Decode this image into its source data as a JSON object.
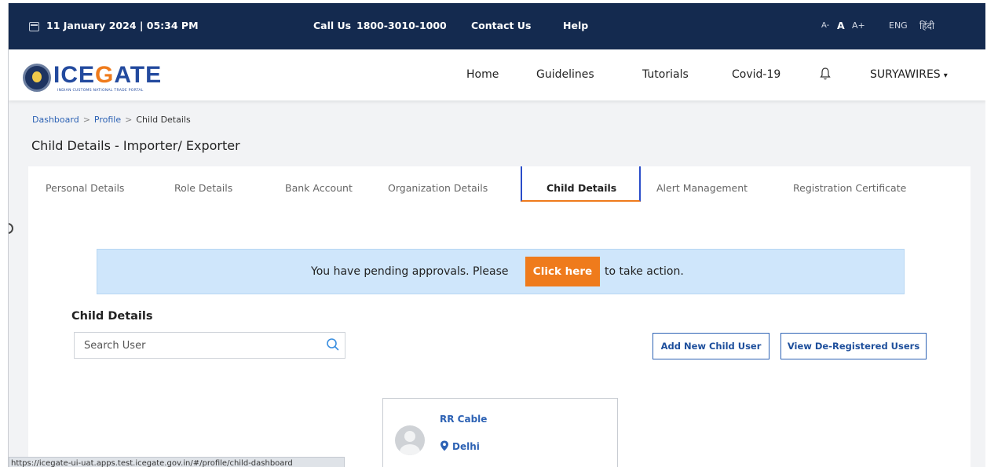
{
  "topbar": {
    "datetime": "11 January 2024 | 05:34 PM",
    "call_label": "Call Us",
    "phone": "1800-3010-1000",
    "contact": "Contact Us",
    "help": "Help",
    "font_small": "A-",
    "font_normal": "A",
    "font_large": "A+",
    "lang_eng": "ENG",
    "lang_hindi": "हिंदी"
  },
  "header": {
    "logo_main": "ICEGATE",
    "logo_sub": "INDIAN CUSTOMS NATIONAL TRADE PORTAL",
    "nav": [
      "Home",
      "Guidelines",
      "Tutorials",
      "Covid-19"
    ],
    "user": "SURYAWIRES"
  },
  "breadcrumb": [
    "Dashboard",
    "Profile",
    "Child Details"
  ],
  "page_title": "Child Details - Importer/ Exporter",
  "tabs": [
    "Personal Details",
    "Role Details",
    "Bank Account",
    "Organization Details",
    "Child Details",
    "Alert Management",
    "Registration Certificate"
  ],
  "active_tab": "Child Details",
  "alert": {
    "before": "You have pending approvals. Please",
    "button": "Click here",
    "after": "to take action."
  },
  "section_title": "Child Details",
  "search": {
    "placeholder": "Search User"
  },
  "buttons": {
    "add_child": "Add New Child User",
    "view_dereg": "View De-Registered Users"
  },
  "card": {
    "name": "RR Cable",
    "city": "Delhi"
  },
  "status_url": "https://icegate-ui-uat.apps.test.icegate.gov.in/#/profile/child-dashboard",
  "colors": {
    "navy": "#142a4f",
    "orange": "#ef7b1c",
    "link_blue": "#2d62b4",
    "alert_bg": "#cfe6fb"
  }
}
